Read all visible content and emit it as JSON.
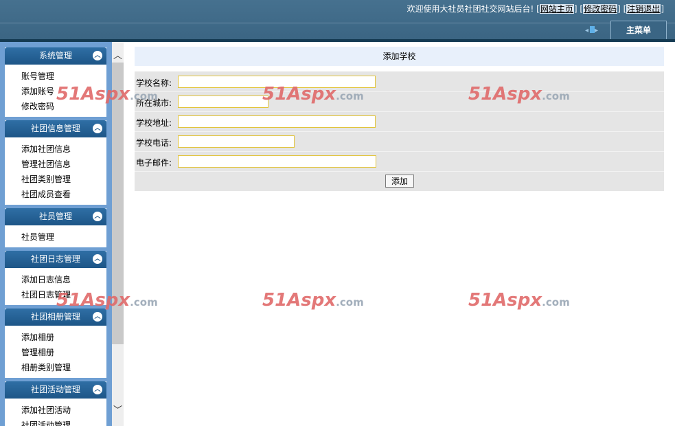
{
  "header": {
    "welcome": "欢迎使用大社员社团社交网站后台!",
    "links": [
      {
        "label": "网站主页"
      },
      {
        "label": "修改密码"
      },
      {
        "label": "注销退出"
      }
    ],
    "main_menu": "主菜单"
  },
  "sidebar": {
    "sections": [
      {
        "title": "系统管理",
        "items": [
          "账号管理",
          "添加账号",
          "修改密码"
        ]
      },
      {
        "title": "社团信息管理",
        "items": [
          "添加社团信息",
          "管理社团信息",
          "社团类别管理",
          "社团成员查看"
        ]
      },
      {
        "title": "社员管理",
        "items": [
          "社员管理"
        ]
      },
      {
        "title": "社团日志管理",
        "items": [
          "添加日志信息",
          "社团日志管理"
        ]
      },
      {
        "title": "社团相册管理",
        "items": [
          "添加相册",
          "管理相册",
          "相册类别管理"
        ]
      },
      {
        "title": "社团活动管理",
        "items": [
          "添加社团活动",
          "社团活动管理"
        ]
      }
    ]
  },
  "content": {
    "title": "添加学校",
    "fields": [
      {
        "label": "学校名称:",
        "value": ""
      },
      {
        "label": "所在城市:",
        "value": ""
      },
      {
        "label": "学校地址:",
        "value": ""
      },
      {
        "label": "学校电话:",
        "value": ""
      },
      {
        "label": "电子邮件:",
        "value": ""
      }
    ],
    "submit_label": "添加"
  },
  "watermark": {
    "brand": "51Aspx",
    "suffix": ".com"
  },
  "colors": {
    "header": "#3d6786",
    "sidebar": "#6f9fd3",
    "section_head": "#1d5687",
    "input_border": "#e2c43a",
    "title_bg": "#e8f0fb"
  }
}
